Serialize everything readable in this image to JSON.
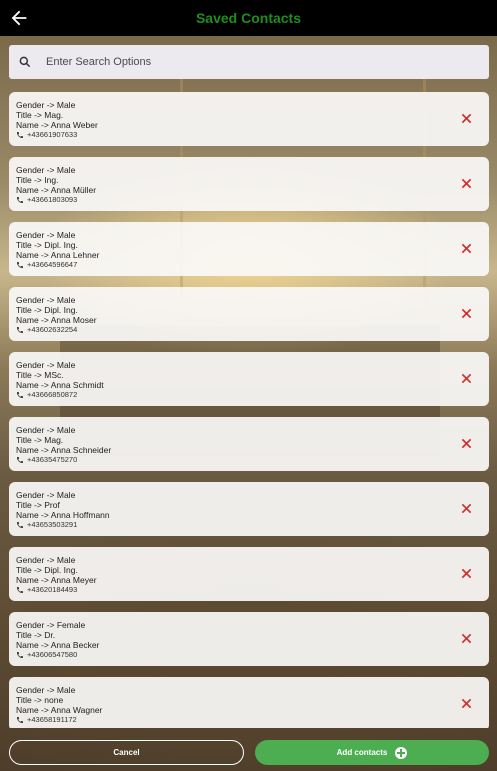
{
  "header": {
    "title": "Saved Contacts",
    "back_icon": "arrow-left-icon"
  },
  "search": {
    "placeholder": "Enter Search Options",
    "value": ""
  },
  "colors": {
    "title": "#1e8e1e",
    "delete": "#d32f2f",
    "accent": "#4cae50"
  },
  "contacts": [
    {
      "gender": "Gender -> Male",
      "title": "Title -> Mag.",
      "name": "Name -> Anna Weber",
      "phone": "+43661907633"
    },
    {
      "gender": "Gender -> Male",
      "title": "Title -> Ing.",
      "name": "Name -> Anna Müller",
      "phone": "+43661803093"
    },
    {
      "gender": "Gender -> Male",
      "title": "Title -> Dipl. Ing.",
      "name": "Name -> Anna Lehner",
      "phone": "+43664596647"
    },
    {
      "gender": "Gender -> Male",
      "title": "Title -> Dipl. Ing.",
      "name": "Name -> Anna Moser",
      "phone": "+43602632254"
    },
    {
      "gender": "Gender -> Male",
      "title": "Title -> MSc.",
      "name": "Name -> Anna Schmidt",
      "phone": "+43666850872"
    },
    {
      "gender": "Gender -> Male",
      "title": "Title -> Mag.",
      "name": "Name -> Anna Schneider",
      "phone": "+43635475270"
    },
    {
      "gender": "Gender -> Male",
      "title": "Title -> Prof",
      "name": "Name -> Anna Hoffmann",
      "phone": "+43653503291"
    },
    {
      "gender": "Gender -> Male",
      "title": "Title -> Dipl. Ing.",
      "name": "Name -> Anna Meyer",
      "phone": "+43620184493"
    },
    {
      "gender": "Gender -> Female",
      "title": "Title -> Dr.",
      "name": "Name -> Anna Becker",
      "phone": "+43606547580"
    },
    {
      "gender": "Gender -> Male",
      "title": "Title -> none",
      "name": "Name -> Anna Wagner",
      "phone": "+43658191172"
    }
  ],
  "footer": {
    "cancel_label": "Cancel",
    "add_label": "Add contacts"
  }
}
